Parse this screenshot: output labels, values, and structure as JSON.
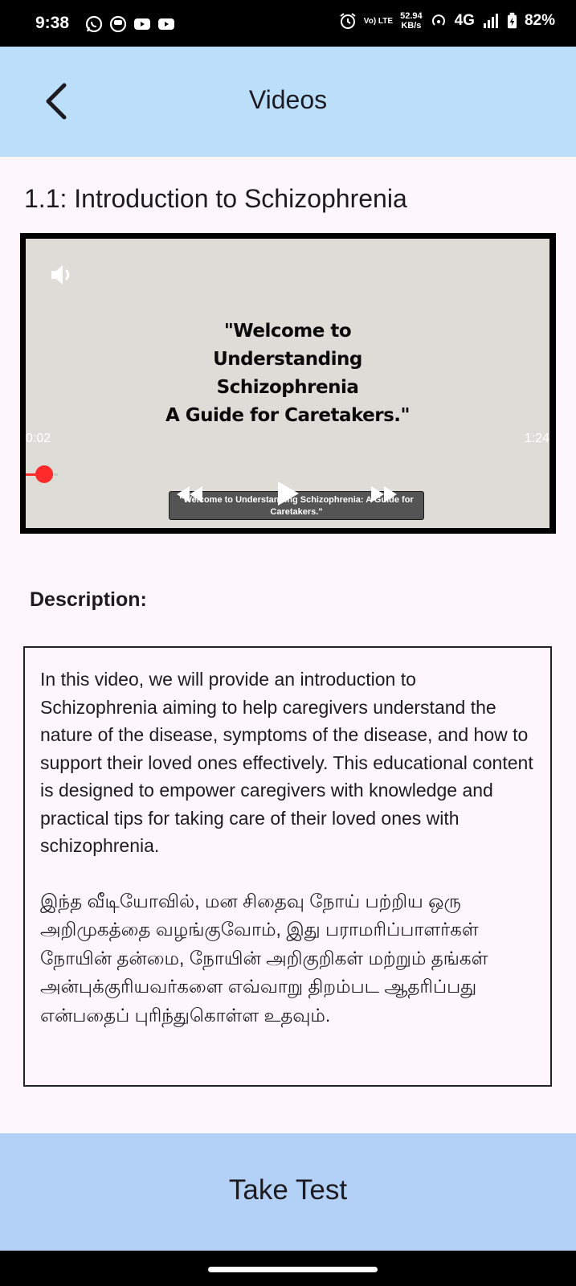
{
  "status_bar": {
    "time": "9:38",
    "left_icons": [
      "whatsapp-icon",
      "notification-icon",
      "youtube-icon",
      "youtube-icon"
    ],
    "volte_label": "Vo) LTE",
    "net_speed_value": "52.94",
    "net_speed_unit": "KB/s",
    "network_type": "4G",
    "battery_percent": "82%"
  },
  "app_bar": {
    "title": "Videos",
    "back_icon": "chevron-left-icon",
    "background": "#bbdefb"
  },
  "lesson": {
    "title": "1.1: Introduction to Schizophrenia"
  },
  "video": {
    "slide_lines": [
      "\"Welcome to",
      "Understanding",
      "Schizophrenia",
      "A Guide for Caretakers.\""
    ],
    "elapsed": "0:02",
    "duration": "1:24",
    "progress_fraction": 0.024,
    "caption_line1": "\"Welcome to Understanding Schizophrenia: A Guide for",
    "caption_line2": "Caretakers.\"",
    "progress_color": "#ff2a2a",
    "icons": [
      "volume-icon",
      "rewind-icon",
      "play-icon",
      "fast-forward-icon"
    ]
  },
  "description": {
    "label": "Description:",
    "english": "In this video, we will provide an introduction to Schizophrenia aiming to help caregivers understand the nature of the disease, symptoms of the disease, and how to support their loved ones effectively. This educational content is designed to empower caregivers with knowledge and practical tips for taking care of their loved ones with schizophrenia.",
    "tamil": "இந்த வீடியோவில், மன சிதைவு நோய் பற்றிய ஒரு அறிமுகத்தை வழங்குவோம், இது பராமரிப்பாளர்கள் நோயின் தன்மை, நோயின் அறிகுறிகள் மற்றும் தங்கள் அன்புக்குரியவர்களை எவ்வாறு திறம்பட ஆதரிப்பது என்பதைப் புரிந்துகொள்ள உதவும்."
  },
  "footer": {
    "take_test_label": "Take Test",
    "background": "#b3d0f6"
  }
}
